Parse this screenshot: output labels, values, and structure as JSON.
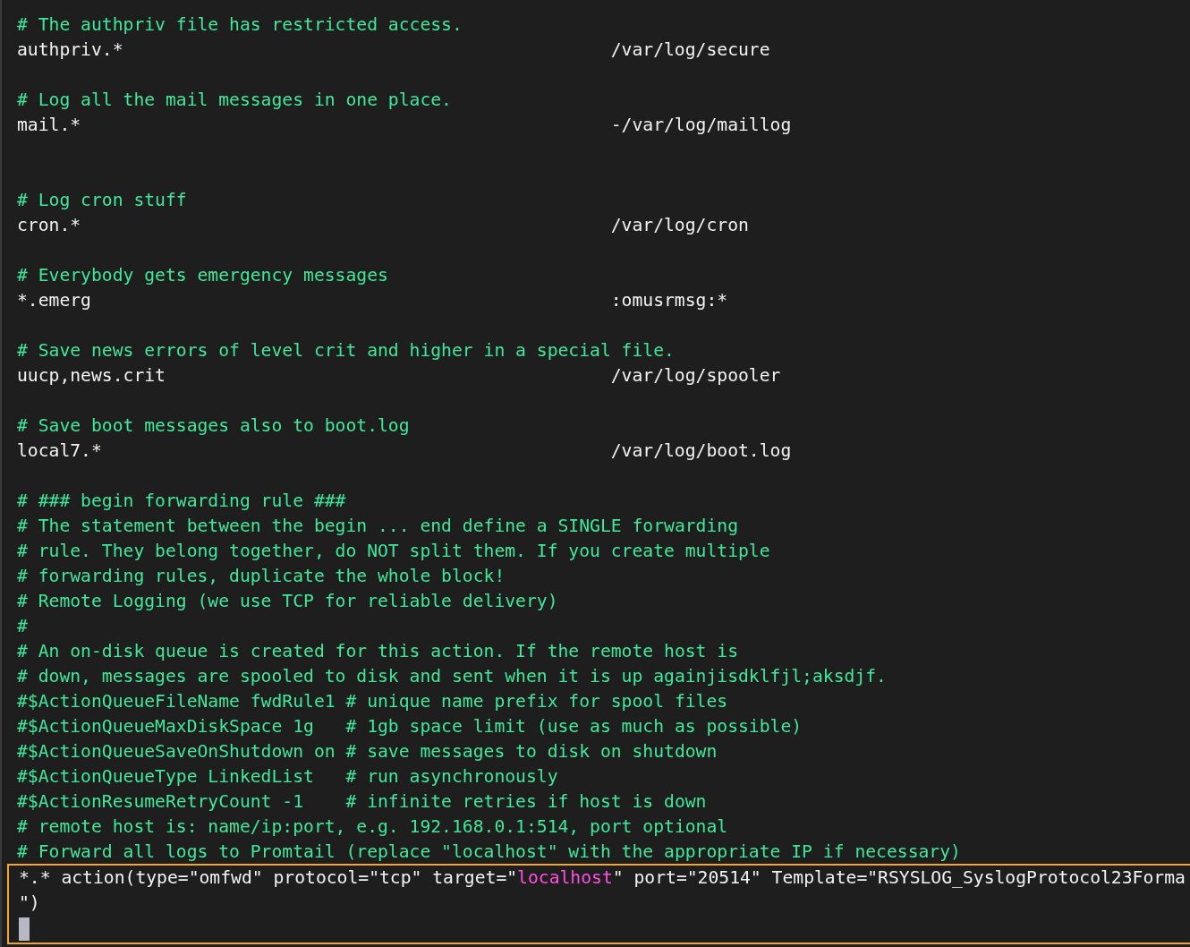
{
  "editor": {
    "lines": [
      {
        "kind": "comment",
        "text": "# The authpriv file has restricted access."
      },
      {
        "kind": "rule",
        "selector": "authpriv.*",
        "target": "/var/log/secure"
      },
      {
        "kind": "blank"
      },
      {
        "kind": "comment",
        "text": "# Log all the mail messages in one place."
      },
      {
        "kind": "rule",
        "selector": "mail.*",
        "target": "-/var/log/maillog"
      },
      {
        "kind": "blank"
      },
      {
        "kind": "blank"
      },
      {
        "kind": "comment",
        "text": "# Log cron stuff"
      },
      {
        "kind": "rule",
        "selector": "cron.*",
        "target": "/var/log/cron"
      },
      {
        "kind": "blank"
      },
      {
        "kind": "comment",
        "text": "# Everybody gets emergency messages"
      },
      {
        "kind": "rule",
        "selector": "*.emerg",
        "target": ":omusrmsg:*"
      },
      {
        "kind": "blank"
      },
      {
        "kind": "comment",
        "text": "# Save news errors of level crit and higher in a special file."
      },
      {
        "kind": "rule",
        "selector": "uucp,news.crit",
        "target": "/var/log/spooler"
      },
      {
        "kind": "blank"
      },
      {
        "kind": "comment",
        "text": "# Save boot messages also to boot.log"
      },
      {
        "kind": "rule",
        "selector": "local7.*",
        "target": "/var/log/boot.log"
      },
      {
        "kind": "blank"
      },
      {
        "kind": "comment",
        "text": "# ### begin forwarding rule ###"
      },
      {
        "kind": "comment",
        "text": "# The statement between the begin ... end define a SINGLE forwarding"
      },
      {
        "kind": "comment",
        "text": "# rule. They belong together, do NOT split them. If you create multiple"
      },
      {
        "kind": "comment",
        "text": "# forwarding rules, duplicate the whole block!"
      },
      {
        "kind": "comment",
        "text": "# Remote Logging (we use TCP for reliable delivery)"
      },
      {
        "kind": "comment",
        "text": "#"
      },
      {
        "kind": "comment",
        "text": "# An on-disk queue is created for this action. If the remote host is"
      },
      {
        "kind": "comment",
        "text": "# down, messages are spooled to disk and sent when it is up againjisdklfjl;aksdjf."
      },
      {
        "kind": "comment",
        "text": "#$ActionQueueFileName fwdRule1 # unique name prefix for spool files"
      },
      {
        "kind": "comment",
        "text": "#$ActionQueueMaxDiskSpace 1g   # 1gb space limit (use as much as possible)"
      },
      {
        "kind": "comment",
        "text": "#$ActionQueueSaveOnShutdown on # save messages to disk on shutdown"
      },
      {
        "kind": "comment",
        "text": "#$ActionQueueType LinkedList   # run asynchronously"
      },
      {
        "kind": "comment",
        "text": "#$ActionResumeRetryCount -1    # infinite retries if host is down"
      },
      {
        "kind": "comment",
        "text": "# remote host is: name/ip:port, e.g. 192.168.0.1:514, port optional"
      },
      {
        "kind": "comment",
        "text": "# Forward all logs to Promtail (replace \"localhost\" with the appropriate IP if necessary)"
      }
    ],
    "selection": {
      "lines": [
        {
          "kind": "code",
          "segments": [
            {
              "text": "*.* action(type=\"omfwd\" protocol=\"tcp\" target=\"",
              "highlight": false
            },
            {
              "text": "localhost",
              "highlight": true
            },
            {
              "text": "\" port=\"20514\" Template=\"RSYSLOG_SyslogProtocol23Forma",
              "highlight": false
            }
          ]
        },
        {
          "kind": "code",
          "segments": [
            {
              "text": "\")",
              "highlight": false
            }
          ]
        },
        {
          "kind": "cursor"
        }
      ]
    }
  }
}
